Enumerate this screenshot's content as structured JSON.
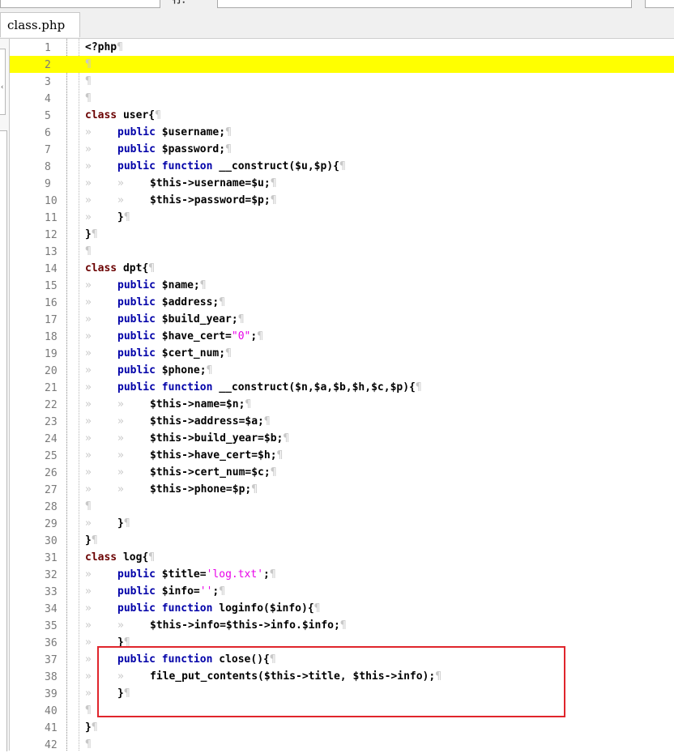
{
  "toolbar": {
    "label": "行："
  },
  "tab": {
    "title": "class.php"
  },
  "highlight_color": "#ffff00",
  "line_numbers": [
    "1",
    "2",
    "3",
    "4",
    "5",
    "6",
    "7",
    "8",
    "9",
    "10",
    "11",
    "12",
    "13",
    "14",
    "15",
    "16",
    "17",
    "18",
    "19",
    "20",
    "21",
    "22",
    "23",
    "24",
    "25",
    "26",
    "27",
    "28",
    "29",
    "30",
    "31",
    "32",
    "33",
    "34",
    "35",
    "36",
    "37",
    "38",
    "39",
    "40",
    "41",
    "42"
  ],
  "lines": [
    {
      "tabs": 0,
      "tokens": [
        [
          "",
          "<?php"
        ]
      ]
    },
    {
      "tabs": 0,
      "tokens": [],
      "highlight": true
    },
    {
      "tabs": 0,
      "tokens": []
    },
    {
      "tabs": 0,
      "tokens": []
    },
    {
      "tabs": 0,
      "tokens": [
        [
          "kw",
          "class"
        ],
        [
          "",
          " user{"
        ]
      ]
    },
    {
      "tabs": 1,
      "tokens": [
        [
          "kw2",
          "public"
        ],
        [
          "",
          " $username;"
        ]
      ]
    },
    {
      "tabs": 1,
      "tokens": [
        [
          "kw2",
          "public"
        ],
        [
          "",
          " $password;"
        ]
      ]
    },
    {
      "tabs": 1,
      "tokens": [
        [
          "kw2",
          "public"
        ],
        [
          "",
          " "
        ],
        [
          "kw2",
          "function"
        ],
        [
          "",
          " __construct($u,$p){"
        ]
      ]
    },
    {
      "tabs": 2,
      "tokens": [
        [
          "",
          "$this->username=$u;"
        ]
      ]
    },
    {
      "tabs": 2,
      "tokens": [
        [
          "",
          "$this->password=$p;"
        ]
      ]
    },
    {
      "tabs": 1,
      "tokens": [
        [
          "",
          "}"
        ]
      ]
    },
    {
      "tabs": 0,
      "tokens": [
        [
          "",
          "}"
        ]
      ]
    },
    {
      "tabs": 0,
      "tokens": []
    },
    {
      "tabs": 0,
      "tokens": [
        [
          "kw",
          "class"
        ],
        [
          "",
          " dpt{"
        ]
      ]
    },
    {
      "tabs": 1,
      "tokens": [
        [
          "kw2",
          "public"
        ],
        [
          "",
          " $name;"
        ]
      ]
    },
    {
      "tabs": 1,
      "tokens": [
        [
          "kw2",
          "public"
        ],
        [
          "",
          " $address;"
        ]
      ]
    },
    {
      "tabs": 1,
      "tokens": [
        [
          "kw2",
          "public"
        ],
        [
          "",
          " $build_year;"
        ]
      ]
    },
    {
      "tabs": 1,
      "tokens": [
        [
          "kw2",
          "public"
        ],
        [
          "",
          " $have_cert="
        ],
        [
          "str",
          "\"0\""
        ],
        [
          "",
          ";"
        ]
      ]
    },
    {
      "tabs": 1,
      "tokens": [
        [
          "kw2",
          "public"
        ],
        [
          "",
          " $cert_num;"
        ]
      ]
    },
    {
      "tabs": 1,
      "tokens": [
        [
          "kw2",
          "public"
        ],
        [
          "",
          " $phone;"
        ]
      ]
    },
    {
      "tabs": 1,
      "tokens": [
        [
          "kw2",
          "public"
        ],
        [
          "",
          " "
        ],
        [
          "kw2",
          "function"
        ],
        [
          "",
          " __construct($n,$a,$b,$h,$c,$p){"
        ]
      ]
    },
    {
      "tabs": 2,
      "tokens": [
        [
          "",
          "$this->name=$n;"
        ]
      ]
    },
    {
      "tabs": 2,
      "tokens": [
        [
          "",
          "$this->address=$a;"
        ]
      ]
    },
    {
      "tabs": 2,
      "tokens": [
        [
          "",
          "$this->build_year=$b;"
        ]
      ]
    },
    {
      "tabs": 2,
      "tokens": [
        [
          "",
          "$this->have_cert=$h;"
        ]
      ]
    },
    {
      "tabs": 2,
      "tokens": [
        [
          "",
          "$this->cert_num=$c;"
        ]
      ]
    },
    {
      "tabs": 2,
      "tokens": [
        [
          "",
          "$this->phone=$p;"
        ]
      ]
    },
    {
      "tabs": 0,
      "tokens": []
    },
    {
      "tabs": 1,
      "tokens": [
        [
          "",
          "}"
        ]
      ]
    },
    {
      "tabs": 0,
      "tokens": [
        [
          "",
          "}"
        ]
      ]
    },
    {
      "tabs": 0,
      "tokens": [
        [
          "kw",
          "class"
        ],
        [
          "",
          " log{"
        ]
      ]
    },
    {
      "tabs": 1,
      "tokens": [
        [
          "kw2",
          "public"
        ],
        [
          "",
          " $title="
        ],
        [
          "str",
          "'log.txt'"
        ],
        [
          "",
          ";"
        ]
      ]
    },
    {
      "tabs": 1,
      "tokens": [
        [
          "kw2",
          "public"
        ],
        [
          "",
          " $info="
        ],
        [
          "str",
          "''"
        ],
        [
          "",
          ";"
        ]
      ]
    },
    {
      "tabs": 1,
      "tokens": [
        [
          "kw2",
          "public"
        ],
        [
          "",
          " "
        ],
        [
          "kw2",
          "function"
        ],
        [
          "",
          " loginfo($info){"
        ]
      ]
    },
    {
      "tabs": 2,
      "tokens": [
        [
          "",
          "$this->info=$this->info.$info;"
        ]
      ]
    },
    {
      "tabs": 1,
      "tokens": [
        [
          "",
          "}"
        ]
      ]
    },
    {
      "tabs": 1,
      "tokens": [
        [
          "kw2",
          "public"
        ],
        [
          "",
          " "
        ],
        [
          "kw2",
          "function"
        ],
        [
          "",
          " close(){"
        ]
      ]
    },
    {
      "tabs": 2,
      "tokens": [
        [
          "",
          "file_put_contents($this->title, $this->info);"
        ]
      ]
    },
    {
      "tabs": 1,
      "tokens": [
        [
          "",
          "}"
        ]
      ]
    },
    {
      "tabs": 0,
      "tokens": []
    },
    {
      "tabs": 0,
      "tokens": [
        [
          "",
          "}"
        ]
      ]
    },
    {
      "tabs": 0,
      "tokens": []
    }
  ],
  "glyphs": {
    "tab": "»",
    "eol": "¶"
  },
  "annotation": {
    "color": "#e0252c"
  }
}
